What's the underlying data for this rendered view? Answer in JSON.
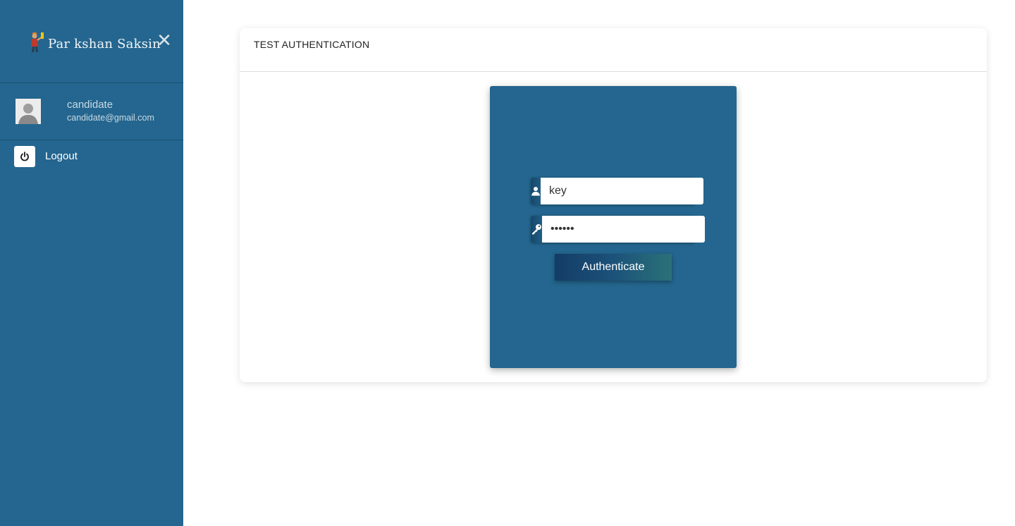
{
  "sidebar": {
    "logo_text": "Par  kshan Saksin",
    "close_glyph": "✕",
    "user": {
      "name": "candidate",
      "email": "candidate@gmail.com"
    },
    "logout_label": "Logout",
    "icons": {
      "logo": "mascot-figure-icon",
      "close": "close-icon",
      "avatar": "user-avatar",
      "logout": "power-icon"
    }
  },
  "main": {
    "card_title": "TEST AUTHENTICATION",
    "form": {
      "key_value": "key",
      "password_value": "123456",
      "authenticate_label": "Authenticate",
      "icons": {
        "key_field": "user-icon",
        "password_field": "key-icon"
      }
    }
  },
  "colors": {
    "sidebar_bg": "#24668f",
    "panel_bg": "#24668f",
    "button_gradient_start": "#133c66",
    "button_gradient_end": "#2a7178"
  }
}
